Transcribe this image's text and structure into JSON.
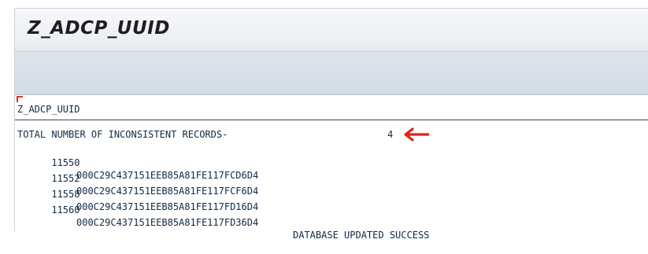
{
  "window": {
    "title": "Z_ADCP_UUID"
  },
  "list": {
    "header": "Z_ADCP_UUID",
    "summary_label": "TOTAL NUMBER OF INCONSISTENT RECORDS-",
    "summary_count": "4",
    "rows": [
      {
        "number": "11550",
        "uuid": "000C29C437151EEB85A81FE117FCD6D4",
        "status": ""
      },
      {
        "number": "11552",
        "uuid": "000C29C437151EEB85A81FE117FCF6D4",
        "status": ""
      },
      {
        "number": "11558",
        "uuid": "000C29C437151EEB85A81FE117FD16D4",
        "status": ""
      },
      {
        "number": "11560",
        "uuid": "000C29C437151EEB85A81FE117FD36D4",
        "status": "DATABASE UPDATED SUCCESS"
      }
    ]
  },
  "colors": {
    "text": "#102a47",
    "arrow": "#e0201b",
    "title_bg": "#eef1f5",
    "toolbar_bg": "#d8e0e8"
  },
  "icons": {
    "annotation": "left-arrow-icon"
  }
}
